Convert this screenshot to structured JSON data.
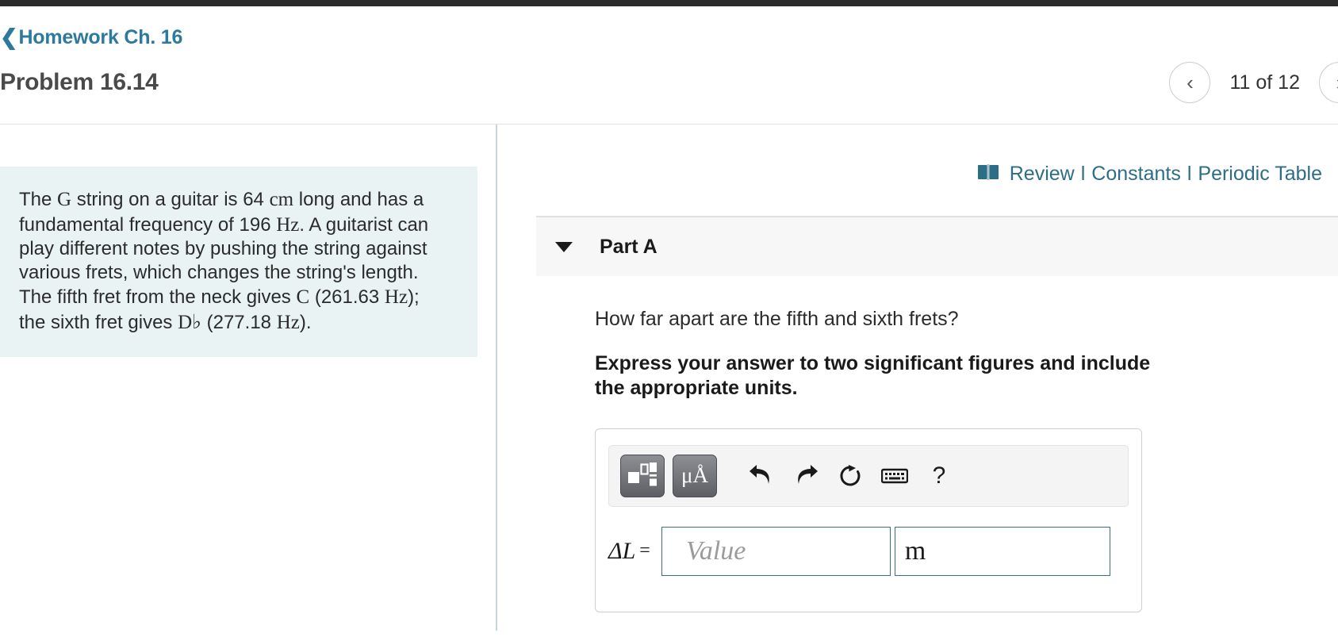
{
  "header": {
    "breadcrumb_label": "Homework Ch. 16",
    "breadcrumb_back_icon": "chevron-left-icon",
    "page_title": "Problem 16.14",
    "pager": {
      "prev_icon": "chevron-left-icon",
      "next_icon": "chevron-right-icon",
      "counter": "11 of 12"
    }
  },
  "left_panel": {
    "problem_text": {
      "seg1": "The ",
      "sym1": "G",
      "seg2": " string on a guitar is 64 ",
      "sym2": "cm",
      "seg3": " long and has a fundamental frequency of 196 ",
      "sym3": "Hz",
      "seg4": ". A guitarist can play different notes by pushing the string against various frets, which changes the string's length. The fifth fret from the neck gives ",
      "sym4": "C",
      "seg5": " (261.63 ",
      "sym5": "Hz",
      "seg6": "); the sixth fret gives ",
      "sym6": "D♭",
      "seg7": " (277.18 ",
      "sym7": "Hz",
      "seg8": ")."
    }
  },
  "right_panel": {
    "util_links": {
      "book_icon": "open-book-icon",
      "review": "Review",
      "separator": "l",
      "constants": "Constants",
      "periodic_table": "Periodic Table"
    },
    "part": {
      "toggle_icon": "caret-down-icon",
      "label": "Part A"
    },
    "question": "How far apart are the fifth and sixth frets?",
    "instruction": "Express your answer to two significant figures and include the appropriate units.",
    "answer": {
      "toolbar": {
        "template_button_icon": "math-template-icon",
        "units_button_label": "μÅ",
        "undo_icon": "undo-arrow-icon",
        "redo_icon": "redo-arrow-icon",
        "reset_icon": "reset-circular-arrow-icon",
        "keyboard_icon": "keyboard-icon",
        "help_label": "?"
      },
      "variable_label": "ΔL",
      "equals": "=",
      "value_placeholder": "Value",
      "unit_value": "m"
    }
  },
  "colors": {
    "link_blue": "#2c7a9e",
    "util_link_teal": "#2c6e87",
    "problem_box_bg": "#e9f3f3",
    "input_border": "#3b6e85",
    "topbar": "#2b2b2b"
  }
}
